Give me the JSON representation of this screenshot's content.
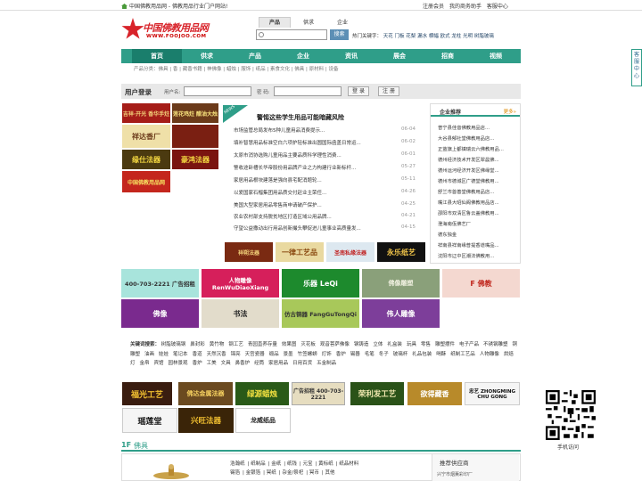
{
  "topbar": {
    "left": "中国佛教用品网 - 佛教用品行业门户网站!",
    "right": [
      "注册会员",
      "我的商务助手",
      "客服中心"
    ]
  },
  "logo": {
    "name": "中国佛教用品网",
    "url": "WWW.FOOJOO.COM"
  },
  "search": {
    "tabs": [
      "产品",
      "供求",
      "企业"
    ],
    "button": "搜索",
    "hot_label": "热门关键字：",
    "hot_words": [
      "天花",
      "门板",
      "花梨",
      "漏水",
      "横幅",
      "欧式",
      "龙柱",
      "光明",
      "树脂玻璃"
    ]
  },
  "nav": [
    "首页",
    "供求",
    "产品",
    "企业",
    "资讯",
    "展会",
    "招商",
    "视频"
  ],
  "subnav": "产品分类：佛具 | 香 | 藏香书籍 | 神佛像 | 蜡烛 | 服饰 | 纸品 | 素食文化 | 佛具 | 原材料 | 设备",
  "side_widget": [
    "客",
    "服",
    "中",
    "心"
  ],
  "login": {
    "title": "用户登录",
    "user_label": "用户名:",
    "pass_label": "密 码:",
    "login_btn": "登 录",
    "reg_btn": "注 册"
  },
  "news": {
    "badge": "NEWS",
    "headline": "警惕这些学生用品可能暗藏风险",
    "items": [
      {
        "t": "市场监管总局发布5种儿童用品消费提示...",
        "d": "06-04"
      },
      {
        "t": "填补智慧用品标准空白六项护轻标准出圆国际函盖日常运...",
        "d": "06-02"
      },
      {
        "t": "太原市消协选购儿童用品主要品质科学理性消费...",
        "d": "06-01"
      },
      {
        "t": "警收途卧槽长华帝股份用品牌产业之力构建行业新标杆...",
        "d": "05-27"
      },
      {
        "t": "家居用品根块建落是强向县宅配消题轮...",
        "d": "05-11"
      },
      {
        "t": "以爱国家石榴集团用品质交付赶业主荣任...",
        "d": "04-26"
      },
      {
        "t": "美国大型家居用品零售商申请破产保护...",
        "d": "04-25"
      },
      {
        "t": "农业农村部支持脱贫地区打造区域公用品牌...",
        "d": "04-21"
      },
      {
        "t": "守望公益撒动出行用品创新撮头攀促进儿童事业高质量发...",
        "d": "04-15"
      }
    ]
  },
  "enterprise": {
    "title": "企业推荐",
    "more": "更多»",
    "items": [
      "普宁县佳音佛教用品店...",
      "大谷县郁社堂佛教用品店...",
      "正蓝旗上都镇瑞云六佛教用品...",
      "德州经济技术开发区翠晨佛...",
      "德州运河经济开发区佛缘堂...",
      "德州市德城区广德堂佛教用...",
      "舒兰市首善堂佛教用品店...",
      "嘴江县大昭仙阁佛教用品店...",
      "邵阳市双清区鲁云盖佛教用...",
      "澄海南佤佛艺厂",
      "德东独金",
      "祥南县祥南缘普提香道嘴品...",
      "沈阳市辽中区潮法佛教用..."
    ]
  },
  "ads_left": [
    "吉祥·开光 香华手炷",
    "莲花鸡炷 醋油大烛",
    "祥达香厂",
    "缘仕法器",
    "豪鸿法器",
    "中国佛教用品网"
  ],
  "ads_news": [
    "祥朔法器",
    "一律工艺品",
    "圣南私缘法器",
    "永乐纸艺"
  ],
  "ads_row1": [
    "400-703-2221 广告招租",
    "人物雕像 RenWuDiaoXiang",
    "乐器 LeQi",
    "佛像雕塑",
    "F 佛教"
  ],
  "ads_row2": [
    "佛像",
    "书法",
    "仿古铜器 FangGuTongQi",
    "伟人雕像"
  ],
  "keywords_label": "关键词搜索：",
  "keywords": [
    "树脂玻璃钢",
    "鼻封彩",
    "黄竹物",
    "钢工艺",
    "青园直养存量",
    "效果图",
    "灭花板",
    "观音菩萨佛像",
    "钢铸造",
    "立体",
    "礼盒装",
    "玩具",
    "零售",
    "雕塑摆件",
    "电子产品",
    "不锈钢雕塑",
    "铜雕塑",
    "油画",
    "娃娃",
    "笔记本",
    "香道",
    "天然沉香",
    "锦亮",
    "天宫瓷器",
    "缎品",
    "景墨",
    "竹签螺蛳",
    "灯饰",
    "香炉",
    "锡器",
    "毛笔",
    "冬子",
    "玻璃杯",
    "礼品包装",
    "喝酥",
    "纸制工艺品",
    "人物雕像",
    "烘焙灯",
    "金帛",
    "宾馆",
    "园林景观",
    "香炉",
    "工美",
    "文具",
    "鼻香炉",
    "经筒",
    "家居用品",
    "日用百货",
    "五金制品"
  ],
  "ads_bottom": [
    "福光工艺",
    "佛达金属法器",
    "绿源蜡烛",
    "广告招租 400-703-2221",
    "荣利发工艺",
    "欲得藏香",
    "忠艺 ZHONGMING CHU GONG",
    "瑶莲堂",
    "兴旺法器",
    "龙威纸品"
  ],
  "qr_caption": "手机访问",
  "floor": {
    "num": "1F",
    "title": "佛具"
  },
  "floor_links": [
    "浩瀚纸",
    "纸制品",
    "金纸",
    "纸钱",
    "元宝",
    "黄标纸",
    "纸品材料",
    "锡箔",
    "金银箔",
    "冥纸",
    "杂金/祭祀",
    "冥币",
    "其他"
  ],
  "supplier": {
    "title": "推荐供应商",
    "first": "兴宁市烟薰彩印厂"
  }
}
